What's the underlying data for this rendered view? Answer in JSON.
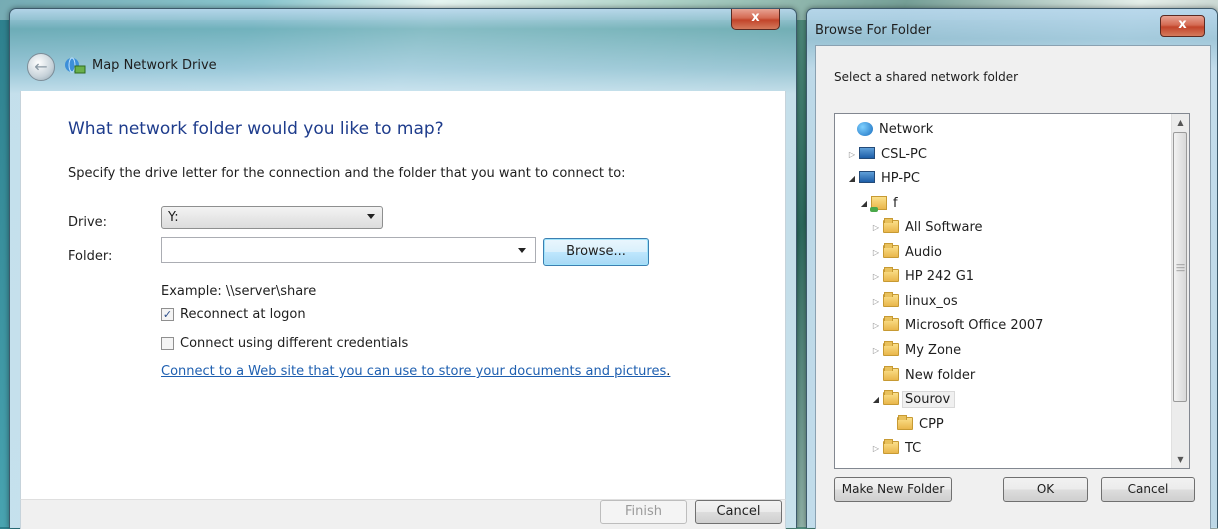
{
  "map_drive": {
    "close_label": "x",
    "title": "Map Network Drive",
    "heading": "What network folder would you like to map?",
    "instruction": "Specify the drive letter for the connection and the folder that you want to connect to:",
    "drive_label": "Drive:",
    "drive_value": "Y:",
    "folder_label": "Folder:",
    "folder_value": "",
    "browse_label": "Browse...",
    "example": "Example: \\\\server\\share",
    "reconnect_label": "Reconnect at logon",
    "reconnect_checked": true,
    "credentials_label": "Connect using different credentials",
    "credentials_checked": false,
    "web_link": "Connect to a Web site that you can use to store your documents and pictures",
    "web_link_suffix": ".",
    "finish_label": "Finish",
    "cancel_label": "Cancel"
  },
  "browse_folder": {
    "title": "Browse For Folder",
    "close_label": "x",
    "prompt": "Select a shared network folder",
    "tree": [
      {
        "label": "Network",
        "icon": "network-icon",
        "expander": "none"
      },
      {
        "label": "CSL-PC",
        "icon": "computer-icon",
        "expander": "collapsed"
      },
      {
        "label": "HP-PC",
        "icon": "computer-icon",
        "expander": "expanded"
      },
      {
        "label": "f",
        "icon": "shared-folder-icon",
        "expander": "expanded"
      },
      {
        "label": "All Software",
        "icon": "folder-icon",
        "expander": "collapsed"
      },
      {
        "label": "Audio",
        "icon": "folder-icon",
        "expander": "collapsed"
      },
      {
        "label": "HP 242 G1",
        "icon": "folder-icon",
        "expander": "collapsed"
      },
      {
        "label": "linux_os",
        "icon": "folder-icon",
        "expander": "collapsed"
      },
      {
        "label": "Microsoft Office 2007",
        "icon": "folder-icon",
        "expander": "collapsed"
      },
      {
        "label": "My Zone",
        "icon": "folder-icon",
        "expander": "collapsed"
      },
      {
        "label": "New folder",
        "icon": "folder-icon",
        "expander": "none"
      },
      {
        "label": "Sourov",
        "icon": "folder-icon",
        "expander": "expanded",
        "selected": true
      },
      {
        "label": "CPP",
        "icon": "folder-icon",
        "expander": "none"
      },
      {
        "label": "TC",
        "icon": "folder-icon",
        "expander": "collapsed"
      }
    ],
    "make_new_folder_label": "Make New Folder",
    "ok_label": "OK",
    "cancel_label": "Cancel"
  },
  "colors": {
    "heading": "#1e3c8c",
    "link": "#1e5fb0",
    "close_button": "#c2442a"
  }
}
